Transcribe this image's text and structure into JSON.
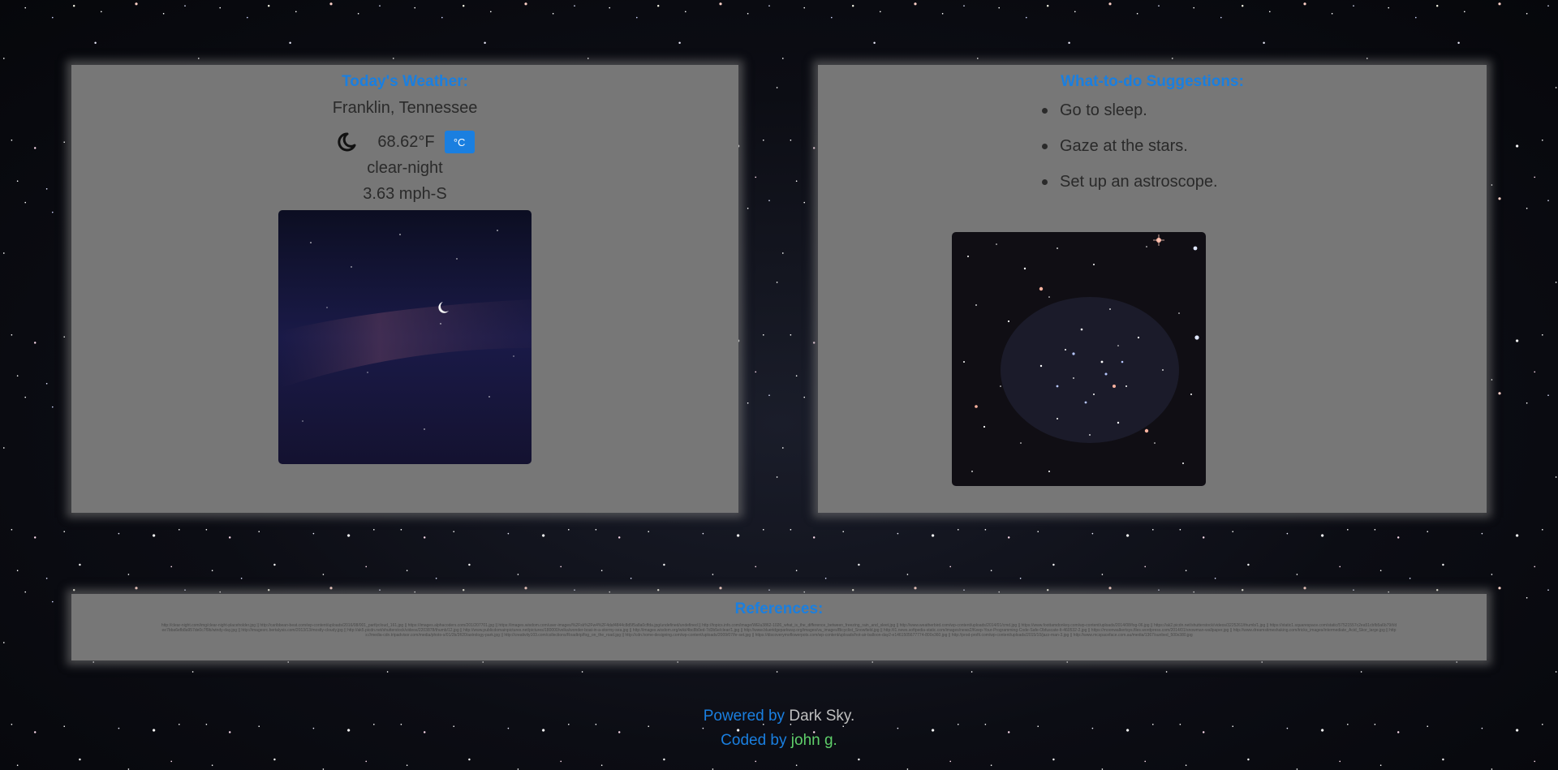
{
  "weather": {
    "title": "Today's Weather:",
    "location": "Franklin, Tennessee",
    "icon": "moon-crescent-icon",
    "temperature": "68.62°F",
    "unit_toggle_label": "°C",
    "summary": "clear-night",
    "wind": "3.63 mph-S",
    "image": "clear-night-sky"
  },
  "suggestions": {
    "title": "What-to-do Suggestions:",
    "items": [
      "Go to sleep.",
      "Gaze at the stars.",
      "Set up an astroscope."
    ],
    "image": "star-cluster"
  },
  "references": {
    "title": "References:",
    "text": "http://clear-night.com/img/clear-night-placeholder.jpg || http://caribbean-beat.com/wp-content/uploads/2016/08/001_partlycloud_161.jpg || https://images.alphacoders.com/201/207701.jpg || https://images.wisdom.com/user-images/%2Fsk%2Fw4%2F4daf4844c8d5f5a8a0cffda.jpg/undefined/undefined || http://topics.info.com/image/WElu3862-1026_what_is_the_difference_between_freezing_rain_and_sleet.jpg || http://www.weatherbird.com/wp-content/uploads/2014/01/cmd.jpg || https://www.foottamdonkey.com/wp-content/uploads/2014/08/fog-06.jpg || https://ak2.picdn.net/shutterstock/videos/3225261/thumb/1.jpg || https://static1.squarespace.com/static/57521557c2ea51cbfb5a6b79/t/dee7bba6efb8a957de0c7f9b/windy-day.jpg || http://imagesrc.bertalysis.com/2013/13/mostly-cloudy.jpg || http://ak5.picdn.net/shutterstock/videos/2203878/thumb/12.jpg || http://www.publicdomainpictures.net/pictures/180000/velka/wonder-boat-in-a-stormy-sea.jpg || http://images.wisdom.org/wiki/4bc8b0ed-7d3b5e/clear/1.jpg || http://www.blueridgeparkway.org/images/va_images/Bicyclist_Snowfield.jpg || http://i1.news.softpedia-static.com/images/news2/Keep-Your-Programming-Code-Safe-Obfuscate-It-460532-2.jpg || https://moonwalkertsys.files.wordpress.com/2014/01/snowman-wallpaper.jpg || http://www.dreamstimeshaking.com/tricks_images/intermediate_Acid_Skor_large.jpg || https://media-cdn.tripadvisor.com/media/photo-s/01/2b/3f/20/astrology-park.jpg || http://creativity103.com/collections/Roadtrip/fog_on_the_road.jpg || http://cdn.home-designing.com/wp-content/uploads/2009/07/hr-set.jpg || https://discoverymoflowerpots.com/wp-content/uploads/hot-air-balloon-day2-e1461505677774-800x360.jpg || http://prod-profit.com/wp-content/uploads/2015/10/jazz-man-3.jpg || http://www.mcspaceface.com.au/media/1367/sunbed_500x380.jpg"
  },
  "footer": {
    "powered_prefix": "Powered by",
    "powered_name": "Dark Sky.",
    "coded_prefix": "Coded by",
    "coded_name": "john g."
  },
  "colors": {
    "accent": "#1a7fe0",
    "panel": "#777777",
    "author": "#5fcf6a"
  }
}
